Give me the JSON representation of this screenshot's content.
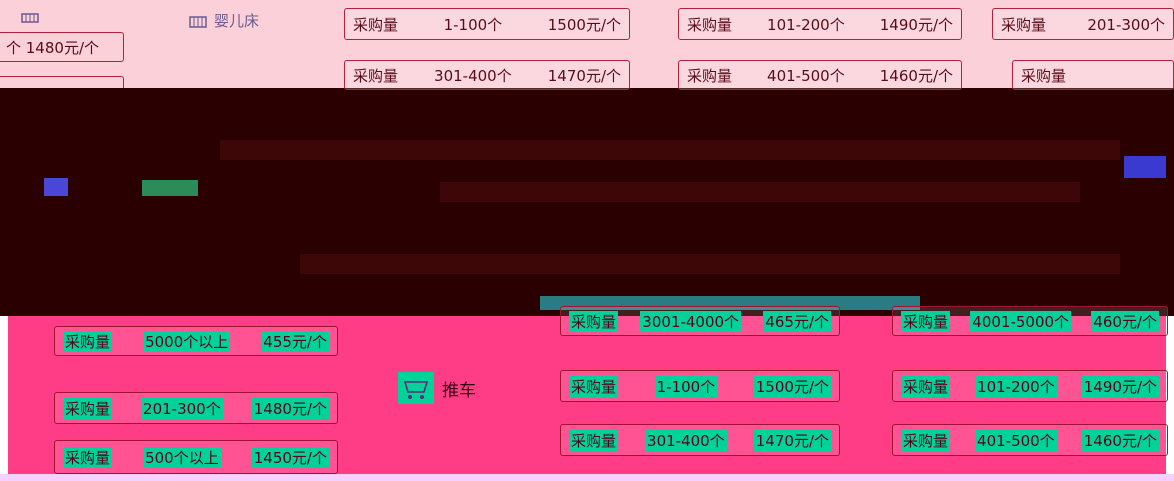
{
  "categories": {
    "crib": "婴儿床",
    "bed": "婴儿床"
  },
  "top_row_1": [
    {
      "label": "采购量",
      "range": "1-100个",
      "price": "1500元/个"
    },
    {
      "label": "采购量",
      "range": "101-200个",
      "price": "1490元/个"
    },
    {
      "label": "采购量",
      "range": "201-300个",
      "price": ""
    }
  ],
  "left_price": "个 1480元/个",
  "top_row_2": [
    {
      "label": "采购量",
      "range": "301-400个",
      "price": "1470元/个"
    },
    {
      "label": "采购量",
      "range": "401-500个",
      "price": "1460元/个"
    },
    {
      "label": "采购量",
      "range": "",
      "price": ""
    }
  ],
  "pink_row_1": [
    {
      "label": "采购量",
      "range": "5000个以上",
      "price": "455元/个"
    },
    {
      "label": "采购量",
      "range": "3001-4000个",
      "price": "465元/个"
    },
    {
      "label": "采购量",
      "range": "4001-5000个",
      "price": "460元/个"
    }
  ],
  "cart": {
    "label": "推车"
  },
  "pink_row_2": [
    {
      "label": "采购量",
      "range": "201-300个",
      "price": "1480元/个"
    },
    {
      "label": "采购量",
      "range": "1-100个",
      "price": "1500元/个"
    },
    {
      "label": "采购量",
      "range": "101-200个",
      "price": "1490元/个"
    }
  ],
  "pink_row_3": [
    {
      "label": "采购量",
      "range": "500个以上",
      "price": "1450元/个"
    },
    {
      "label": "采购量",
      "range": "301-400个",
      "price": "1470元/个"
    },
    {
      "label": "采购量",
      "range": "401-500个",
      "price": "1460元/个"
    }
  ]
}
